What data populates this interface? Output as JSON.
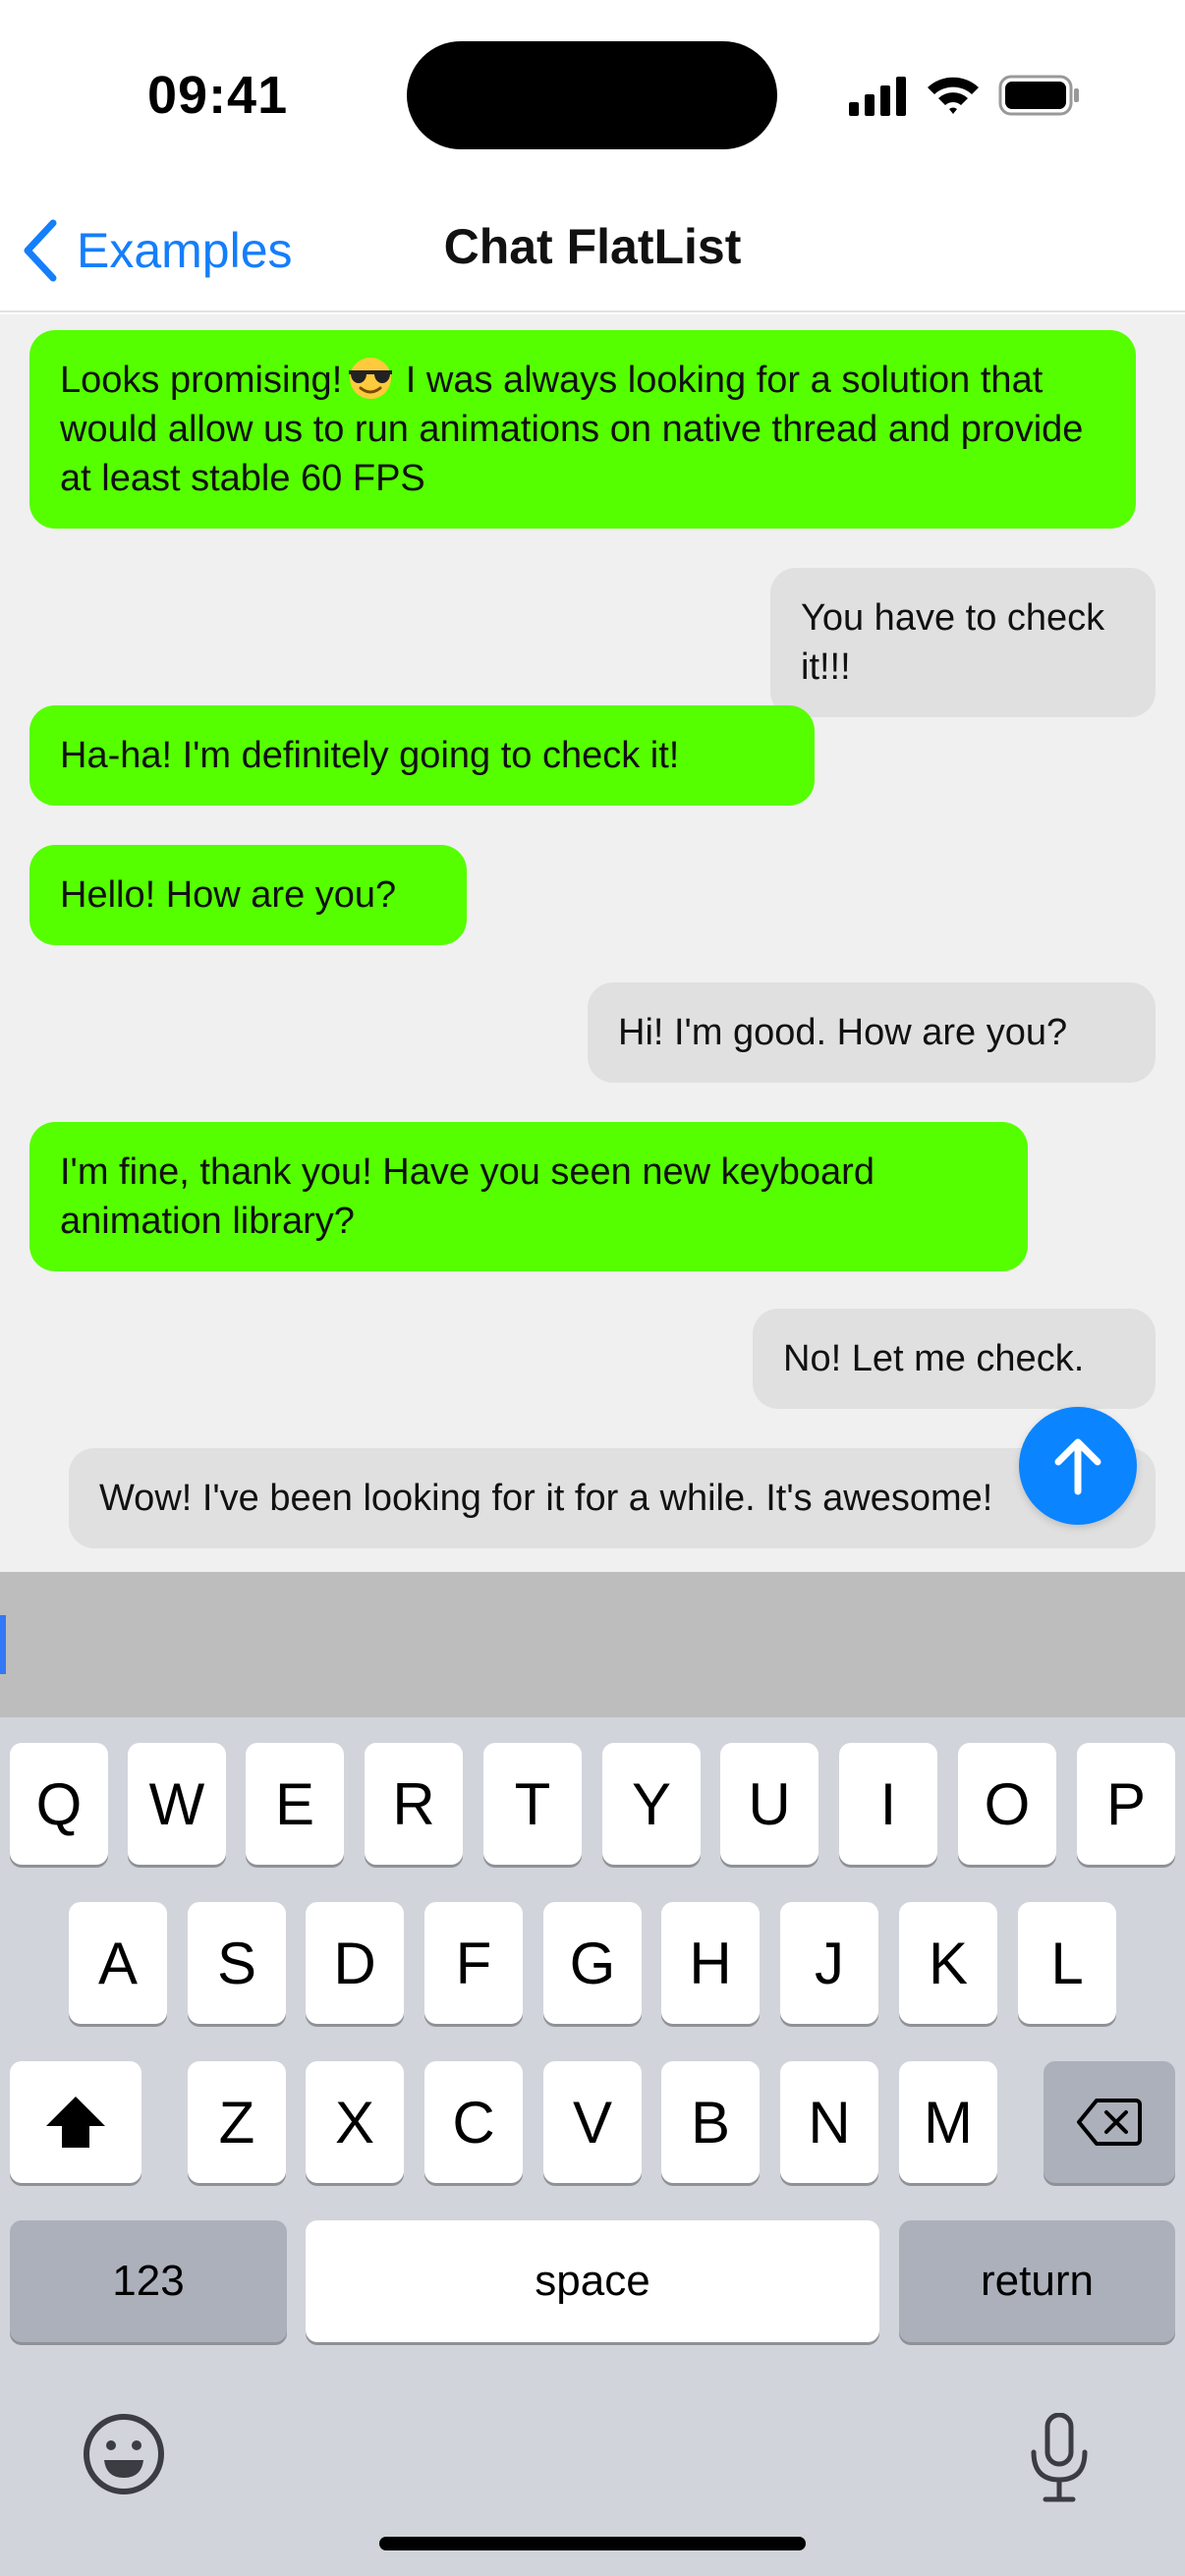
{
  "status_bar": {
    "time": "09:41",
    "icons": [
      "cellular-signal-icon",
      "wifi-icon",
      "battery-icon"
    ]
  },
  "nav": {
    "back_label": "Examples",
    "title": "Chat FlatList"
  },
  "messages": [
    {
      "side": "left",
      "text_before_emoji": "Looks promising!",
      "emoji": "smiling-face-with-sunglasses",
      "text_after_emoji": " I was always looking for a solution that would allow us to run animations on native thread and provide at least stable 60 FPS"
    },
    {
      "side": "right",
      "text": "You have to check it!!!"
    },
    {
      "side": "left",
      "text": "Ha-ha! I'm definitely going to check it!"
    },
    {
      "side": "left",
      "text": "Hello! How are you?"
    },
    {
      "side": "right",
      "text": "Hi! I'm good. How are you?"
    },
    {
      "side": "left",
      "text": "I'm fine, thank you! Have you seen new keyboard animation library?"
    },
    {
      "side": "right",
      "text": "No! Let me check."
    },
    {
      "side": "right",
      "text": "Wow! I've been looking for it for a while. It's awesome!"
    }
  ],
  "scroll_button": {
    "icon": "arrow-up-icon"
  },
  "input": {
    "value": ""
  },
  "keyboard": {
    "row1": [
      "Q",
      "W",
      "E",
      "R",
      "T",
      "Y",
      "U",
      "I",
      "O",
      "P"
    ],
    "row2": [
      "A",
      "S",
      "D",
      "F",
      "G",
      "H",
      "J",
      "K",
      "L"
    ],
    "row3": [
      "Z",
      "X",
      "C",
      "V",
      "B",
      "N",
      "M"
    ],
    "shift_icon": "shift-icon",
    "delete_icon": "delete-icon",
    "numbers_label": "123",
    "space_label": "space",
    "return_label": "return",
    "emoji_icon": "emoji-icon",
    "mic_icon": "microphone-icon"
  },
  "colors": {
    "accent": "#147efb",
    "incoming_bubble": "#55ff00",
    "outgoing_bubble": "#e0e0e0",
    "fab": "#0a84ff",
    "chat_background": "#f0f0f0",
    "keyboard_background": "#d1d4db"
  }
}
